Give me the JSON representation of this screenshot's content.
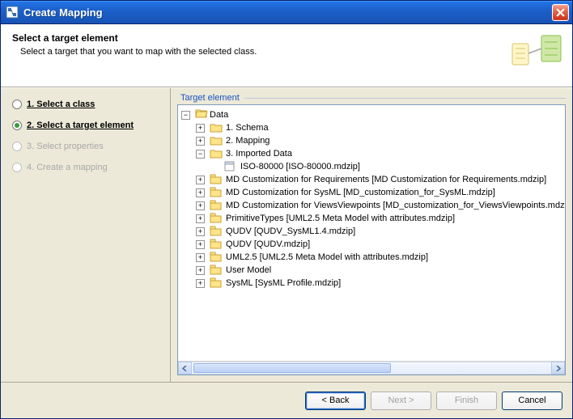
{
  "window": {
    "title": "Create Mapping"
  },
  "header": {
    "title": "Select a target element",
    "subtitle": "Select a target that you want to map with the selected class."
  },
  "wizard": {
    "steps": [
      {
        "label": "1. Select a class",
        "state": "done"
      },
      {
        "label": "2. Select a target element",
        "state": "active"
      },
      {
        "label": "3. Select properties",
        "state": "disabled"
      },
      {
        "label": "4. Create a mapping",
        "state": "disabled"
      }
    ]
  },
  "right": {
    "group_label": "Target element"
  },
  "tree": {
    "root": {
      "toggle": "-",
      "icon": "folder-open",
      "label": "Data"
    },
    "children": [
      {
        "toggle": "+",
        "icon": "folder",
        "label": "1. Schema"
      },
      {
        "toggle": "+",
        "icon": "folder",
        "label": "2. Mapping"
      },
      {
        "toggle": "-",
        "icon": "folder",
        "label": "3. Imported Data",
        "children": [
          {
            "toggle": "",
            "icon": "file",
            "label": "ISO-80000 [ISO-80000.mdzip]"
          }
        ]
      },
      {
        "toggle": "+",
        "icon": "pkg",
        "label": "MD Customization for Requirements [MD Customization for Requirements.mdzip]"
      },
      {
        "toggle": "+",
        "icon": "pkg",
        "label": "MD Customization for SysML [MD_customization_for_SysML.mdzip]"
      },
      {
        "toggle": "+",
        "icon": "pkg",
        "label": "MD Customization for ViewsViewpoints [MD_customization_for_ViewsViewpoints.mdzip]"
      },
      {
        "toggle": "+",
        "icon": "pkg",
        "label": "PrimitiveTypes [UML2.5 Meta Model with attributes.mdzip]"
      },
      {
        "toggle": "+",
        "icon": "pkg",
        "label": "QUDV [QUDV_SysML1.4.mdzip]"
      },
      {
        "toggle": "+",
        "icon": "pkg",
        "label": "QUDV [QUDV.mdzip]"
      },
      {
        "toggle": "+",
        "icon": "pkg",
        "label": "UML2.5 [UML2.5 Meta Model with attributes.mdzip]"
      },
      {
        "toggle": "+",
        "icon": "pkg",
        "label": "User Model"
      },
      {
        "toggle": "+",
        "icon": "pkg",
        "label": "SysML [SysML Profile.mdzip]"
      }
    ]
  },
  "buttons": {
    "back": "< Back",
    "next": "Next >",
    "finish": "Finish",
    "cancel": "Cancel"
  }
}
